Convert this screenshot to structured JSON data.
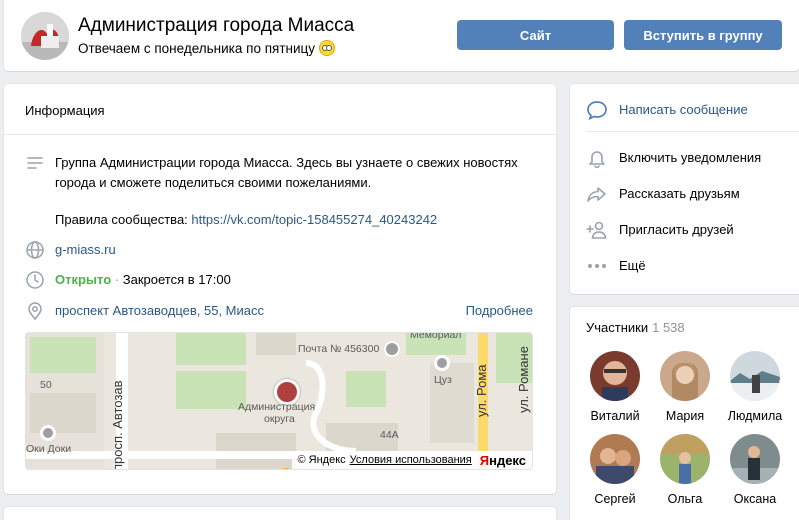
{
  "header": {
    "title": "Администрация города Миасса",
    "status": "Отвечаем с понедельника по пятницу",
    "status_emoji": "smiley-icon",
    "buttons": {
      "site": "Сайт",
      "join": "Вступить в группу"
    },
    "accent_color": "#5181b8"
  },
  "info": {
    "title": "Информация",
    "description": "Группа Администрации города Миасса. Здесь вы узнаете о свежих новостях города и сможете поделиться своими пожеланиями.",
    "rules_label": "Правила сообщества:",
    "rules_link": "https://vk.com/topic-158455274_40243242",
    "site": "g-miass.ru",
    "hours_status": "Открыто",
    "hours_sep": "·",
    "hours_text": "Закроется в 17:00",
    "address": "проспект Автозаводцев, 55, Миасс",
    "more": "Подробнее"
  },
  "map": {
    "labels": {
      "post": "Почта № 456300",
      "memorial": "Мемориал",
      "cuz": "Цуз",
      "admin": "Администрация",
      "admin2": "округа",
      "oki": "Оки Доки",
      "num50": "50",
      "num44a": "44А",
      "road1": "просп. Автозав",
      "road2": "ул. Рома",
      "road3": "ул. Романе"
    },
    "copyright": "© Яндекс",
    "terms": "Условия использования",
    "logo_a": "Я",
    "logo_b": "ндекс"
  },
  "actions": [
    {
      "label": "Написать сообщение",
      "icon": "message-icon"
    },
    {
      "label": "Включить уведомления",
      "icon": "bell-icon"
    },
    {
      "label": "Рассказать друзьям",
      "icon": "share-icon"
    },
    {
      "label": "Пригласить друзей",
      "icon": "add-user-icon"
    },
    {
      "label": "Ещё",
      "icon": "more-icon"
    }
  ],
  "members": {
    "title": "Участники",
    "count": "1 538",
    "list": [
      {
        "name": "Виталий"
      },
      {
        "name": "Мария"
      },
      {
        "name": "Людмила"
      },
      {
        "name": "Сергей"
      },
      {
        "name": "Ольга"
      },
      {
        "name": "Оксана"
      }
    ]
  }
}
